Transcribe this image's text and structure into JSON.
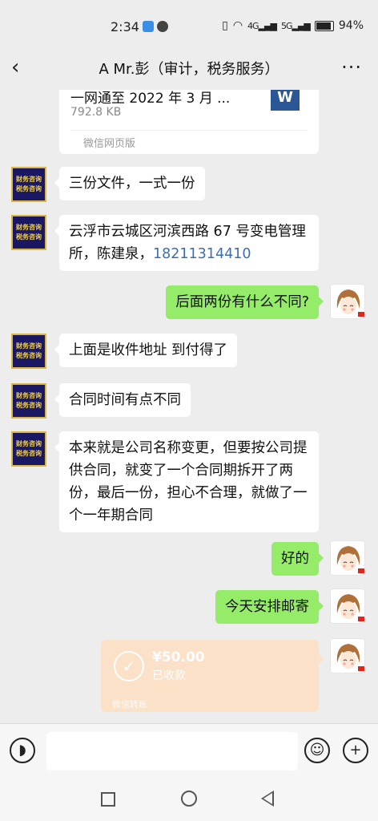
{
  "status_bar": {
    "time": "2:34",
    "battery": "94%",
    "signal_4g": "4G",
    "signal_5g": "5G"
  },
  "nav": {
    "title": "A Mr.彭（审计，税务服务）",
    "back_icon": "back-chevron-icon",
    "more_icon": "more-dots-icon"
  },
  "contact_avatar_text": [
    "财务咨询",
    "税务咨询"
  ],
  "file_card": {
    "name": "一网通至 2022 年 3 月 ...",
    "size": "792.8 KB",
    "type_icon": "W",
    "source": "微信网页版"
  },
  "messages": [
    {
      "from": "them",
      "text": "三份文件，一式一份"
    },
    {
      "from": "them",
      "text": "云浮市云城区河滨西路 67 号变电管理所，陈建泉，",
      "phone": "18211314410"
    },
    {
      "from": "me",
      "text": "后面两份有什么不同?"
    },
    {
      "from": "them",
      "text": "上面是收件地址 到付得了"
    },
    {
      "from": "them",
      "text": "合同时间有点不同"
    },
    {
      "from": "them",
      "text": "本来就是公司名称变更，但要按公司提供合同，就变了一个合同期拆开了两份，最后一份，担心不合理，就做了一个一年期合同"
    },
    {
      "from": "me",
      "text": "好的"
    },
    {
      "from": "me",
      "text": "今天安排邮寄"
    }
  ],
  "transfer": {
    "amount": "¥50.00",
    "status": "已收款",
    "source": "微信转账"
  },
  "input_bar": {
    "voice_icon": "voice-icon",
    "emoji_icon": "emoji-icon",
    "plus_icon": "plus-icon"
  },
  "colors": {
    "background": "#ededed",
    "outgoing_bubble": "#95ec69",
    "incoming_bubble": "#ffffff",
    "transfer_card": "#fbe1c6",
    "phone_link": "#3d6eb2"
  }
}
